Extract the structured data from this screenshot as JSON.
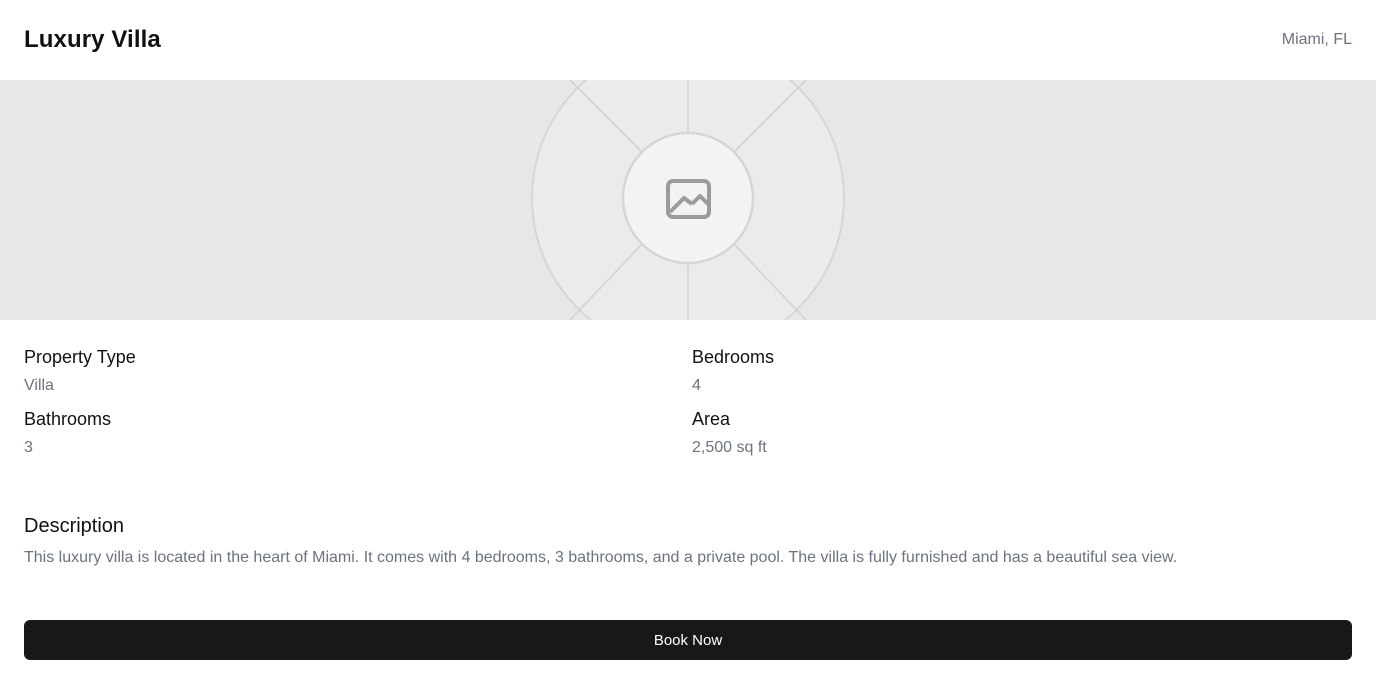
{
  "header": {
    "title": "Luxury Villa",
    "location": "Miami, FL"
  },
  "hero": {
    "icon": "image-placeholder-icon"
  },
  "details": [
    {
      "label": "Property Type",
      "value": "Villa"
    },
    {
      "label": "Bedrooms",
      "value": "4"
    },
    {
      "label": "Bathrooms",
      "value": "3"
    },
    {
      "label": "Area",
      "value": "2,500 sq ft"
    }
  ],
  "description": {
    "heading": "Description",
    "text": "This luxury villa is located in the heart of Miami. It comes with 4 bedrooms, 3 bathrooms, and a private pool. The villa is fully furnished and has a beautiful sea view."
  },
  "actions": {
    "book_label": "Book Now"
  },
  "colors": {
    "button_bg": "#18181b",
    "muted_text": "#6b7280",
    "placeholder_bg": "#e7e7e7"
  }
}
